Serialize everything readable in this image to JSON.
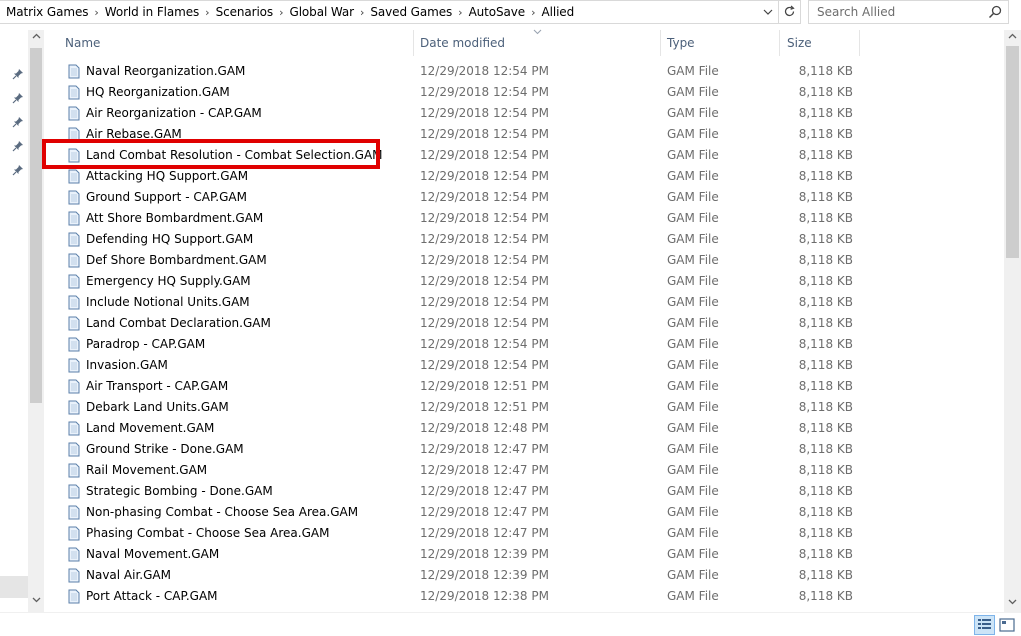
{
  "address": {
    "crumbs": [
      "Matrix Games",
      "World in Flames",
      "Scenarios",
      "Global War",
      "Saved Games",
      "AutoSave",
      "Allied"
    ]
  },
  "search": {
    "placeholder": "Search Allied"
  },
  "columns": {
    "name": "Name",
    "date": "Date modified",
    "type": "Type",
    "size": "Size"
  },
  "files": [
    {
      "name": "Naval Reorganization.GAM",
      "date": "12/29/2018 12:54 PM",
      "type": "GAM File",
      "size": "8,118 KB"
    },
    {
      "name": "HQ Reorganization.GAM",
      "date": "12/29/2018 12:54 PM",
      "type": "GAM File",
      "size": "8,118 KB"
    },
    {
      "name": "Air Reorganization - CAP.GAM",
      "date": "12/29/2018 12:54 PM",
      "type": "GAM File",
      "size": "8,118 KB"
    },
    {
      "name": "Air Rebase.GAM",
      "date": "12/29/2018 12:54 PM",
      "type": "GAM File",
      "size": "8,118 KB"
    },
    {
      "name": "Land Combat Resolution - Combat Selection.GAM",
      "date": "12/29/2018 12:54 PM",
      "type": "GAM File",
      "size": "8,118 KB"
    },
    {
      "name": "Attacking HQ Support.GAM",
      "date": "12/29/2018 12:54 PM",
      "type": "GAM File",
      "size": "8,118 KB"
    },
    {
      "name": "Ground Support - CAP.GAM",
      "date": "12/29/2018 12:54 PM",
      "type": "GAM File",
      "size": "8,118 KB"
    },
    {
      "name": "Att Shore Bombardment.GAM",
      "date": "12/29/2018 12:54 PM",
      "type": "GAM File",
      "size": "8,118 KB"
    },
    {
      "name": "Defending HQ Support.GAM",
      "date": "12/29/2018 12:54 PM",
      "type": "GAM File",
      "size": "8,118 KB"
    },
    {
      "name": "Def Shore Bombardment.GAM",
      "date": "12/29/2018 12:54 PM",
      "type": "GAM File",
      "size": "8,118 KB"
    },
    {
      "name": "Emergency HQ Supply.GAM",
      "date": "12/29/2018 12:54 PM",
      "type": "GAM File",
      "size": "8,118 KB"
    },
    {
      "name": "Include Notional Units.GAM",
      "date": "12/29/2018 12:54 PM",
      "type": "GAM File",
      "size": "8,118 KB"
    },
    {
      "name": "Land Combat Declaration.GAM",
      "date": "12/29/2018 12:54 PM",
      "type": "GAM File",
      "size": "8,118 KB"
    },
    {
      "name": "Paradrop - CAP.GAM",
      "date": "12/29/2018 12:54 PM",
      "type": "GAM File",
      "size": "8,118 KB"
    },
    {
      "name": "Invasion.GAM",
      "date": "12/29/2018 12:54 PM",
      "type": "GAM File",
      "size": "8,118 KB"
    },
    {
      "name": "Air Transport - CAP.GAM",
      "date": "12/29/2018 12:51 PM",
      "type": "GAM File",
      "size": "8,118 KB"
    },
    {
      "name": "Debark Land Units.GAM",
      "date": "12/29/2018 12:51 PM",
      "type": "GAM File",
      "size": "8,118 KB"
    },
    {
      "name": "Land Movement.GAM",
      "date": "12/29/2018 12:48 PM",
      "type": "GAM File",
      "size": "8,118 KB"
    },
    {
      "name": "Ground Strike - Done.GAM",
      "date": "12/29/2018 12:47 PM",
      "type": "GAM File",
      "size": "8,118 KB"
    },
    {
      "name": "Rail Movement.GAM",
      "date": "12/29/2018 12:47 PM",
      "type": "GAM File",
      "size": "8,118 KB"
    },
    {
      "name": "Strategic Bombing - Done.GAM",
      "date": "12/29/2018 12:47 PM",
      "type": "GAM File",
      "size": "8,118 KB"
    },
    {
      "name": "Non-phasing Combat - Choose Sea Area.GAM",
      "date": "12/29/2018 12:47 PM",
      "type": "GAM File",
      "size": "8,118 KB"
    },
    {
      "name": "Phasing Combat - Choose Sea Area.GAM",
      "date": "12/29/2018 12:47 PM",
      "type": "GAM File",
      "size": "8,118 KB"
    },
    {
      "name": "Naval Movement.GAM",
      "date": "12/29/2018 12:39 PM",
      "type": "GAM File",
      "size": "8,118 KB"
    },
    {
      "name": "Naval Air.GAM",
      "date": "12/29/2018 12:39 PM",
      "type": "GAM File",
      "size": "8,118 KB"
    },
    {
      "name": "Port Attack - CAP.GAM",
      "date": "12/29/2018 12:38 PM",
      "type": "GAM File",
      "size": "8,118 KB"
    }
  ],
  "highlight_color": "#e00000"
}
